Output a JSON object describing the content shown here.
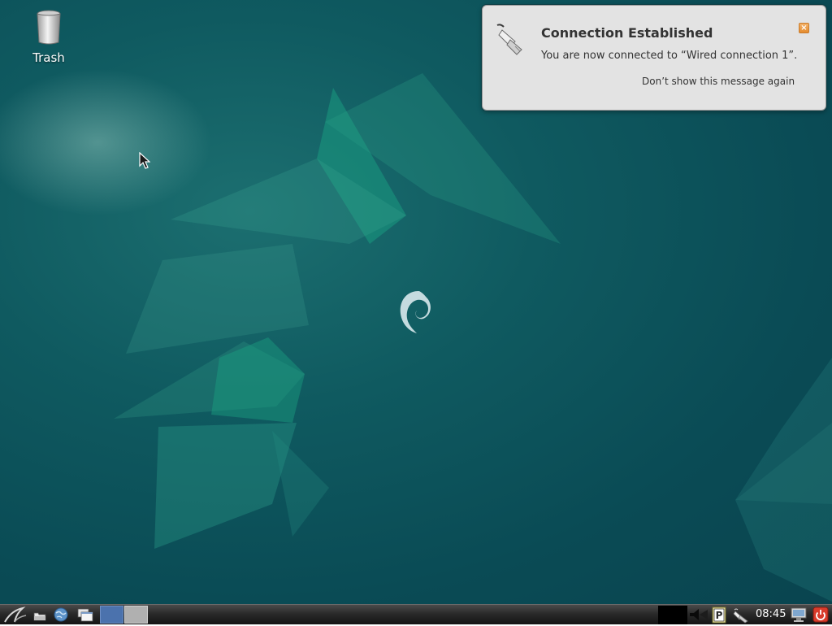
{
  "desktop": {
    "icons": [
      {
        "label": "Trash",
        "icon": "trash-icon"
      }
    ]
  },
  "notification": {
    "title": "Connection Established",
    "body": "You are now connected to “Wired connection 1”.",
    "dont_show": "Don’t show this message again",
    "icon": "network-wired-icon",
    "close_icon": "close-icon"
  },
  "taskbar": {
    "menu_icon": "lxde-menu-icon",
    "launchers": [
      "file-manager-icon",
      "web-browser-icon",
      "window-list-icon"
    ],
    "workspaces": [
      {
        "name": "desktop-1",
        "active": true
      },
      {
        "name": "desktop-2",
        "active": false
      }
    ],
    "tray": [
      "volume-icon",
      "clipboard-p-icon",
      "network-icon",
      "monitor-icon",
      "power-icon"
    ],
    "clock": "08:45"
  },
  "colors": {
    "wallpaper": "#0a4b55",
    "notification_bg": "#e3e3e3",
    "workspace_active": "#4b72ad",
    "power_red": "#d93b2b"
  }
}
